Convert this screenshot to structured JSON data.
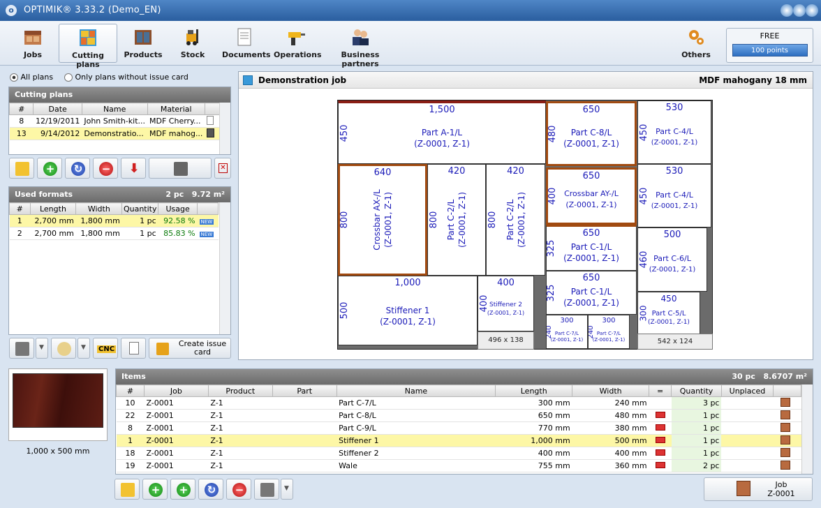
{
  "app": {
    "title": "OPTIMIK® 3.33.2  (Demo_EN)"
  },
  "ribbon": {
    "jobs": "Jobs",
    "cutting_plans": "Cutting plans",
    "products": "Products",
    "stock": "Stock",
    "documents": "Documents",
    "operations": "Operations",
    "business_partners": "Business partners",
    "others": "Others",
    "free": "FREE",
    "points": "100 points"
  },
  "filters": {
    "all": "All plans",
    "without": "Only plans without issue card"
  },
  "cutting_plans": {
    "title": "Cutting plans",
    "cols": [
      "#",
      "Date",
      "Name",
      "Material"
    ],
    "rows": [
      [
        "8",
        "12/19/2011",
        "John Smith-kit...",
        "MDF Cherry..."
      ],
      [
        "13",
        "9/14/2012",
        "Demonstratio...",
        "MDF mahog..."
      ]
    ]
  },
  "used_formats": {
    "title": "Used formats",
    "count": "2 pc",
    "area": "9.72 m²",
    "cols": [
      "#",
      "Length",
      "Width",
      "Quantity",
      "Usage"
    ],
    "rows": [
      [
        "1",
        "2,700 mm",
        "1,800 mm",
        "1 pc",
        "92.58 %"
      ],
      [
        "2",
        "2,700 mm",
        "1,800 mm",
        "1 pc",
        "85.83 %"
      ]
    ],
    "badge": "NEW"
  },
  "bottom_left": {
    "create_issue": "Create issue card",
    "preview_size": "1,000 x 500 mm",
    "cnc": "CNC"
  },
  "layout": {
    "title": "Demonstration job",
    "material": "MDF mahogany 18 mm"
  },
  "pieces": [
    {
      "id": "p1",
      "w": "1,500",
      "h": "450",
      "name": "Part A-1/L",
      "code": "(Z-0001, Z-1)"
    },
    {
      "id": "p2",
      "w": "650",
      "h": "480",
      "name": "Part C-8/L",
      "code": "(Z-0001, Z-1)"
    },
    {
      "id": "p3",
      "w": "530",
      "h": "450",
      "name": "Part C-4/L",
      "code": "(Z-0001, Z-1)"
    },
    {
      "id": "p4",
      "w": "640",
      "h": "800",
      "name": "Crossbar AX-/L",
      "code": "(Z-0001, Z-1)"
    },
    {
      "id": "p5",
      "w": "420",
      "h": "800",
      "name": "Part C-2/L",
      "code": "(Z-0001, Z-1)"
    },
    {
      "id": "p6",
      "w": "420",
      "h": "800",
      "name": "Part C-2/L",
      "code": "(Z-0001, Z-1)"
    },
    {
      "id": "p7",
      "w": "650",
      "h": "400",
      "name": "Crossbar AY-/L",
      "code": "(Z-0001, Z-1)"
    },
    {
      "id": "p8",
      "w": "530",
      "h": "450",
      "name": "Part C-4/L",
      "code": "(Z-0001, Z-1)"
    },
    {
      "id": "p9",
      "w": "650",
      "h": "325",
      "name": "Part C-1/L",
      "code": "(Z-0001, Z-1)"
    },
    {
      "id": "p10",
      "w": "500",
      "h": "460",
      "name": "Part C-6/L",
      "code": "(Z-0001, Z-1)"
    },
    {
      "id": "p11",
      "w": "1,000",
      "h": "500",
      "name": "Stiffener 1",
      "code": "(Z-0001, Z-1)"
    },
    {
      "id": "p12",
      "w": "400",
      "h": "400",
      "name": "Stiffener 2",
      "code": "(Z-0001, Z-1)"
    },
    {
      "id": "p13",
      "w": "650",
      "h": "325",
      "name": "Part C-1/L",
      "code": "(Z-0001, Z-1)"
    },
    {
      "id": "p14",
      "w": "450",
      "h": "300",
      "name": "Part C-5/L",
      "code": "(Z-0001, Z-1)"
    },
    {
      "id": "p15",
      "w": "300",
      "h": "240",
      "name": "Part C-7/L",
      "code": "(Z-0001, Z-1)"
    },
    {
      "id": "p16",
      "w": "300",
      "h": "240",
      "name": "Part C-7/L",
      "code": "(Z-0001, Z-1)"
    }
  ],
  "waste": {
    "a": "496 x 138",
    "b": "542 x 124"
  },
  "items": {
    "title": "Items",
    "count": "30 pc",
    "area": "8.6707 m²",
    "cols": [
      "#",
      "Job",
      "Product",
      "Part",
      "Name",
      "Length",
      "Width",
      "=",
      "Quantity",
      "Unplaced"
    ],
    "rows": [
      [
        "10",
        "Z-0001",
        "Z-1",
        "",
        "Part C-7/L",
        "300 mm",
        "240 mm",
        "",
        "3 pc",
        ""
      ],
      [
        "22",
        "Z-0001",
        "Z-1",
        "",
        "Part C-8/L",
        "650 mm",
        "480 mm",
        "x",
        "1 pc",
        ""
      ],
      [
        "8",
        "Z-0001",
        "Z-1",
        "",
        "Part C-9/L",
        "770 mm",
        "380 mm",
        "x",
        "1 pc",
        ""
      ],
      [
        "1",
        "Z-0001",
        "Z-1",
        "",
        "Stiffener 1",
        "1,000 mm",
        "500 mm",
        "x",
        "1 pc",
        ""
      ],
      [
        "18",
        "Z-0001",
        "Z-1",
        "",
        "Stiffener 2",
        "400 mm",
        "400 mm",
        "x",
        "1 pc",
        ""
      ],
      [
        "19",
        "Z-0001",
        "Z-1",
        "",
        "Wale",
        "755 mm",
        "360 mm",
        "x",
        "2 pc",
        ""
      ]
    ]
  },
  "job_button": {
    "label": "Job",
    "value": "Z-0001"
  }
}
